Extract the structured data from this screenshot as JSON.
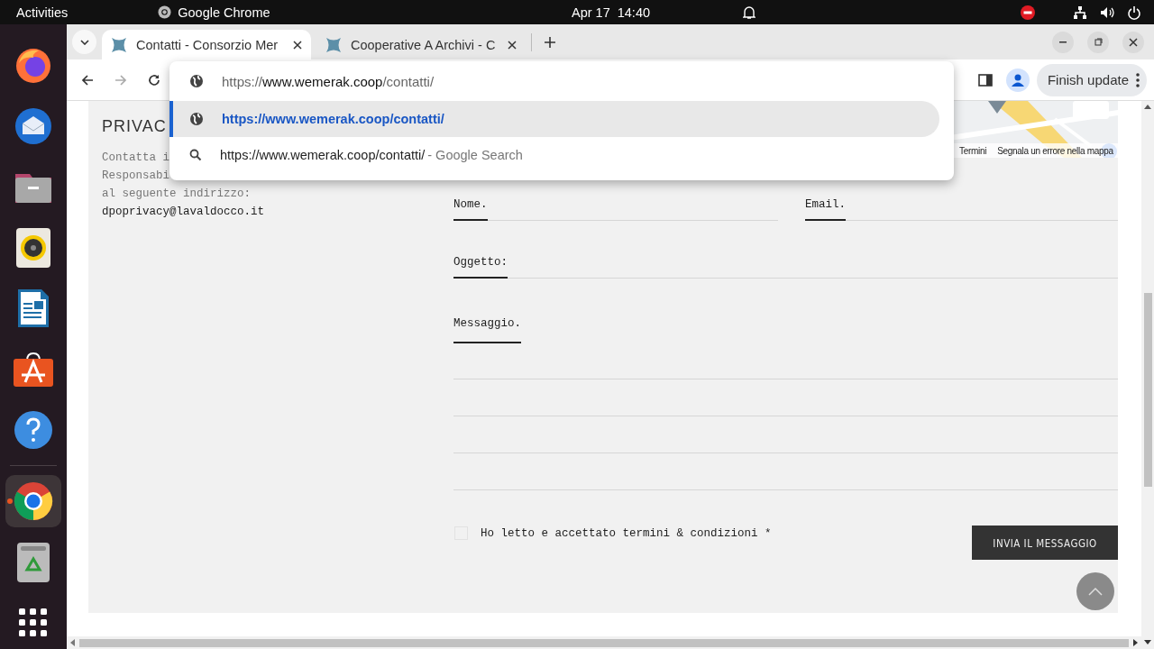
{
  "top_bar": {
    "activities": "Activities",
    "app_name": "Google Chrome",
    "date": "Apr 17",
    "time": "14:40"
  },
  "dock": [
    {
      "kind": "firefox",
      "running": false,
      "selected": false
    },
    {
      "kind": "thunderbird",
      "running": false,
      "selected": false
    },
    {
      "kind": "files",
      "running": false,
      "selected": false
    },
    {
      "kind": "rhythmbox",
      "running": false,
      "selected": false
    },
    {
      "kind": "writer",
      "running": false,
      "selected": false
    },
    {
      "kind": "appstore",
      "running": false,
      "selected": false
    },
    {
      "kind": "help",
      "running": false,
      "selected": false
    },
    {
      "kind": "chrome",
      "running": true,
      "selected": true
    },
    {
      "kind": "trash",
      "running": false,
      "selected": false
    },
    {
      "kind": "apps",
      "running": false,
      "selected": false
    }
  ],
  "tabs": [
    {
      "title": "Contatti - Consorzio Mer",
      "selected": true
    },
    {
      "title": "Cooperative A Archivi - C",
      "selected": false
    }
  ],
  "toolbar": {
    "forward_disabled": true,
    "update_button": "Finish update"
  },
  "omnibox": {
    "scheme": "https://",
    "host": "www.wemerak.coop",
    "path": "/contatti/",
    "suggestions": [
      {
        "kind": "url",
        "text": "https://www.wemerak.coop/contatti/",
        "selected": true
      },
      {
        "kind": "search",
        "text": "https://www.wemerak.coop/contatti/",
        "suffix": "- Google Search",
        "selected": false
      }
    ]
  },
  "page": {
    "privacy": {
      "heading": "PRIVAC",
      "lines": [
        "Contatta i",
        "Responsabi",
        "al seguente indirizzo:",
        "dpoprivacy@lavaldocco.it"
      ]
    },
    "map": {
      "links": [
        "Termini",
        "Segnala un errore nella mappa"
      ]
    },
    "form": {
      "rows": [
        [
          {
            "label": "Nome.",
            "kind": "input"
          },
          {
            "label": "Email.",
            "kind": "input"
          }
        ],
        [
          {
            "label": "Oggetto:",
            "kind": "input"
          }
        ],
        [
          {
            "label": "Messaggio.",
            "kind": "textarea"
          }
        ]
      ],
      "consent": {
        "label": "Ho letto e accettato termini & condizioni *",
        "checked": false
      },
      "submit": "INVIA IL MESSAGGIO"
    }
  }
}
